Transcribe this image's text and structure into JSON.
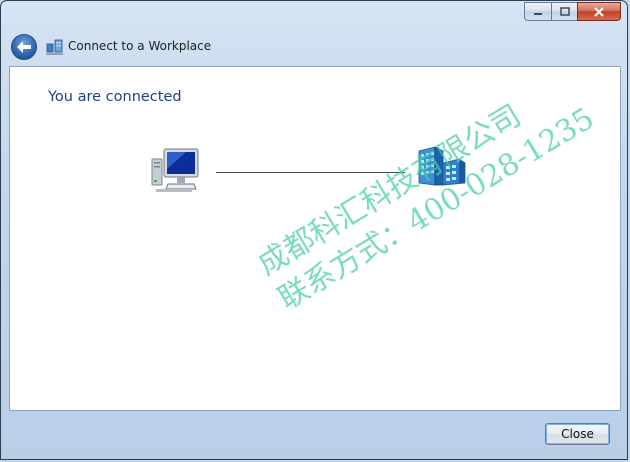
{
  "window": {
    "title": "Connect to a Workplace",
    "caption_buttons": {
      "minimize_icon": "minimize-icon",
      "maximize_icon": "maximize-icon",
      "close_icon": "close-icon"
    }
  },
  "navigation": {
    "back_icon": "back-arrow-icon"
  },
  "content": {
    "heading": "You are connected",
    "left_icon": "computer-icon",
    "right_icon": "workplace-building-icon"
  },
  "watermark": {
    "line1": "成都科汇科技有限公司",
    "line2": "联系方式：400-028-1235"
  },
  "footer": {
    "close_label": "Close"
  },
  "colors": {
    "heading": "#1f3f8f",
    "watermark": "#48cda5",
    "titlebar": "#c2d6ec"
  }
}
